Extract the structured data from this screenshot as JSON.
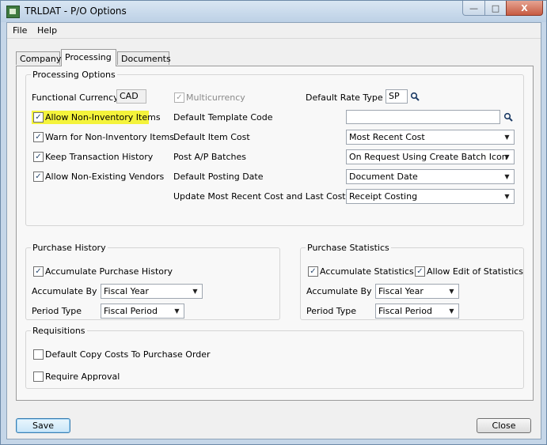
{
  "window": {
    "title": "TRLDAT - P/O Options",
    "min_glyph": "—",
    "max_glyph": "□",
    "close_glyph": "X"
  },
  "menu": {
    "file": "File",
    "help": "Help"
  },
  "tabs": [
    {
      "label": "Company",
      "active": false
    },
    {
      "label": "Processing",
      "active": true
    },
    {
      "label": "Documents",
      "active": false
    }
  ],
  "processing_options": {
    "title": "Processing Options",
    "functional_currency_label": "Functional Currency",
    "functional_currency_value": "CAD",
    "multicurrency_label": "Multicurrency",
    "multicurrency_checked": true,
    "default_rate_type_label": "Default Rate Type",
    "default_rate_type_value": "SP",
    "allow_non_inventory_label": "Allow Non-Inventory Items",
    "allow_non_inventory_checked": true,
    "warn_non_inventory_label": "Warn for Non-Inventory Items",
    "warn_non_inventory_checked": true,
    "keep_transaction_history_label": "Keep Transaction History",
    "keep_transaction_history_checked": true,
    "allow_non_existing_vendors_label": "Allow Non-Existing Vendors",
    "allow_non_existing_vendors_checked": true,
    "default_template_code_label": "Default Template Code",
    "default_template_code_value": "",
    "default_item_cost_label": "Default Item Cost",
    "default_item_cost_value": "Most Recent Cost",
    "post_ap_batches_label": "Post A/P Batches",
    "post_ap_batches_value": "On Request Using Create Batch Icon",
    "default_posting_date_label": "Default Posting Date",
    "default_posting_date_value": "Document Date",
    "update_cost_label": "Update Most Recent Cost and Last Cost At",
    "update_cost_value": "Receipt Costing"
  },
  "purchase_history": {
    "title": "Purchase History",
    "accumulate_label": "Accumulate Purchase History",
    "accumulate_checked": true,
    "accumulate_by_label": "Accumulate By",
    "accumulate_by_value": "Fiscal Year",
    "period_type_label": "Period Type",
    "period_type_value": "Fiscal Period"
  },
  "purchase_statistics": {
    "title": "Purchase Statistics",
    "accumulate_label": "Accumulate Statistics",
    "accumulate_checked": true,
    "allow_edit_label": "Allow Edit of Statistics",
    "allow_edit_checked": true,
    "accumulate_by_label": "Accumulate By",
    "accumulate_by_value": "Fiscal Year",
    "period_type_label": "Period Type",
    "period_type_value": "Fiscal Period"
  },
  "requisitions": {
    "title": "Requisitions",
    "copy_costs_label": "Default Copy Costs To Purchase Order",
    "copy_costs_checked": false,
    "require_approval_label": "Require Approval",
    "require_approval_checked": false
  },
  "buttons": {
    "save": "Save",
    "close": "Close"
  },
  "icons": {
    "finder": "magnifier-icon",
    "dropdown_glyph": "▼"
  },
  "colors": {
    "highlight": "#f4f33b",
    "accent": "#3c7fb1"
  }
}
